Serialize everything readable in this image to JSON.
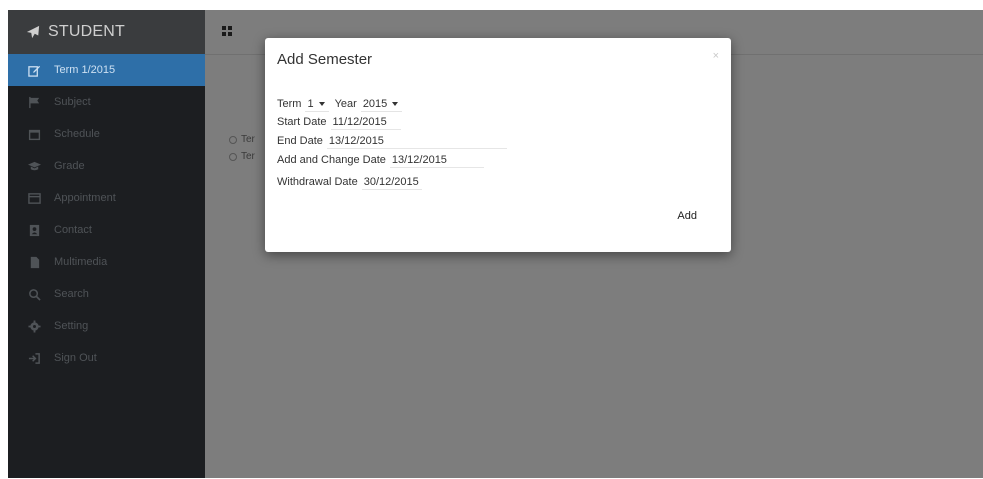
{
  "sidebar": {
    "brand": "STUDENT",
    "items": [
      {
        "label": "Term 1/2015",
        "icon": "edit-icon",
        "active": true
      },
      {
        "label": "Subject",
        "icon": "flag-icon",
        "active": false
      },
      {
        "label": "Schedule",
        "icon": "calendar-icon",
        "active": false
      },
      {
        "label": "Grade",
        "icon": "graduation-cap-icon",
        "active": false
      },
      {
        "label": "Appointment",
        "icon": "calendar-grid-icon",
        "active": false
      },
      {
        "label": "Contact",
        "icon": "contact-book-icon",
        "active": false
      },
      {
        "label": "Multimedia",
        "icon": "file-icon",
        "active": false
      },
      {
        "label": "Search",
        "icon": "search-icon",
        "active": false
      },
      {
        "label": "Setting",
        "icon": "gear-icon",
        "active": false
      },
      {
        "label": "Sign Out",
        "icon": "sign-out-icon",
        "active": false
      }
    ]
  },
  "background": {
    "radio_1": "Ter",
    "radio_2": "Ter"
  },
  "modal": {
    "title": "Add Semester",
    "close": "×",
    "term_label": "Term",
    "term_value": "1",
    "year_label": "Year",
    "year_value": "2015",
    "start_label": "Start Date",
    "start_value": "11/12/2015",
    "end_label": "End Date",
    "end_value": "13/12/2015",
    "addchange_label": "Add and Change Date",
    "addchange_value": "13/12/2015",
    "withdraw_label": "Withdrawal Date",
    "withdraw_value": "30/12/2015",
    "add_button": "Add"
  },
  "colors": {
    "sidebar_bg": "#1c1e21",
    "brand_bg": "#3a3c3e",
    "active_item": "#2e6fa8",
    "overlay": "#7d7d7d"
  }
}
